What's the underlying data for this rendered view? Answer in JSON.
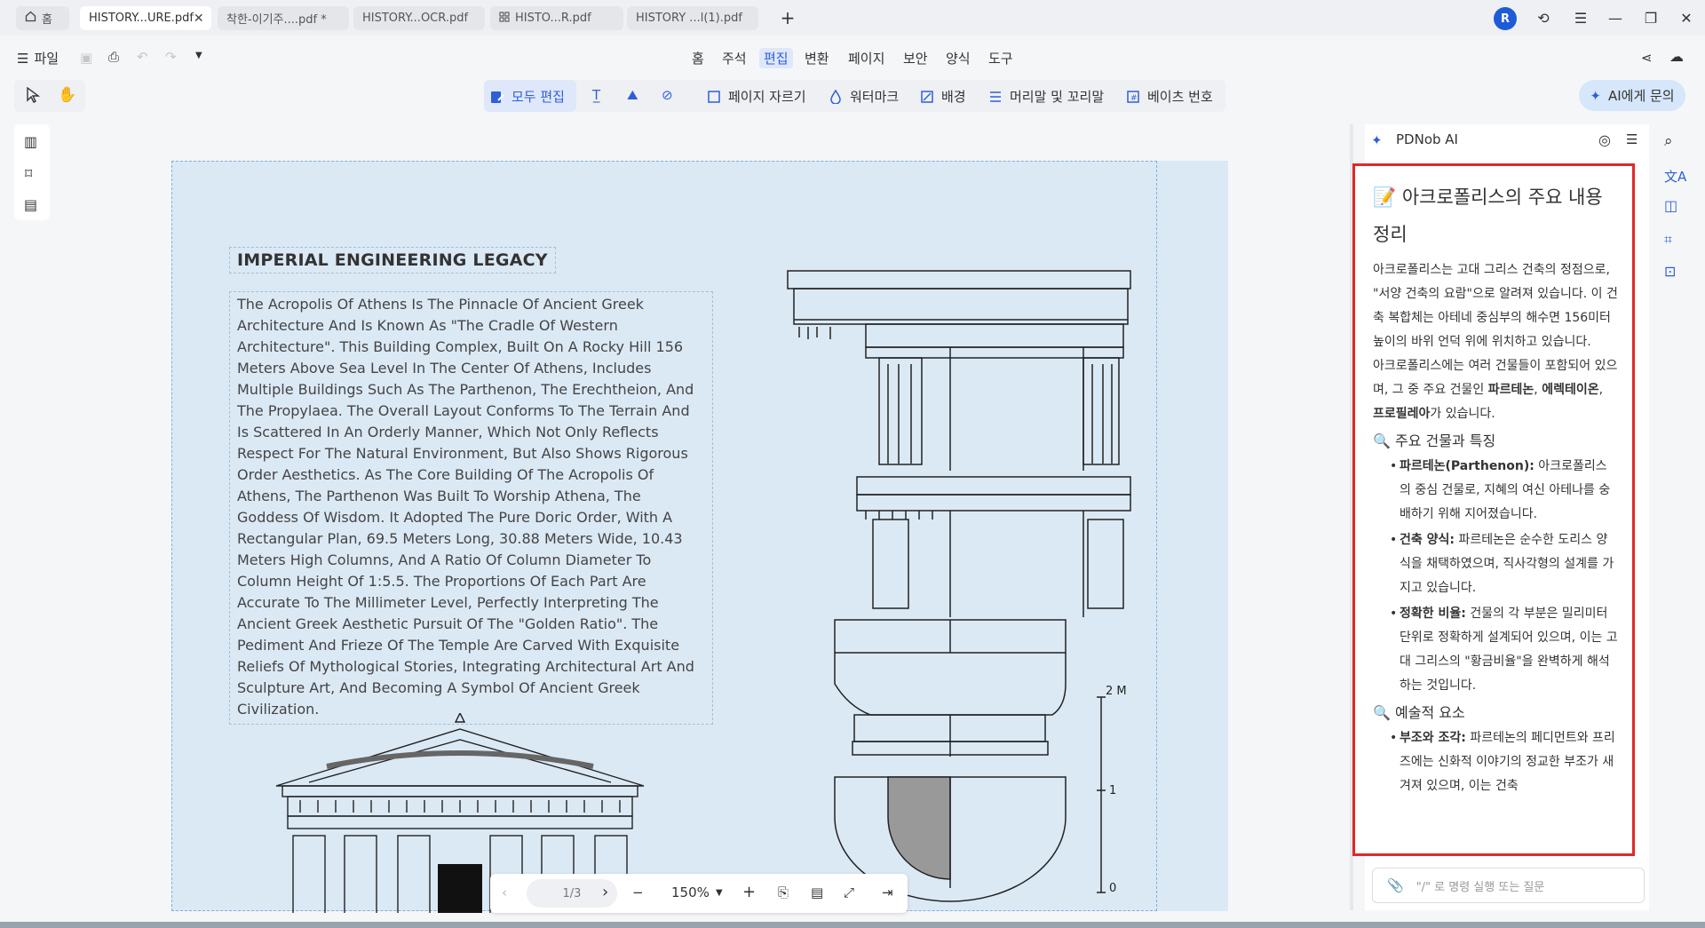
{
  "tabs": [
    {
      "label": "홈",
      "icon": "home-icon"
    },
    {
      "label": "HISTORY...URE.pdf",
      "active": true
    },
    {
      "label": "착한-이기주....pdf *"
    },
    {
      "label": "HISTORY...OCR.pdf"
    },
    {
      "label": "HISTO...R.pdf",
      "icon": "grid-icon"
    },
    {
      "label": "HISTORY ...l(1).pdf"
    }
  ],
  "user": {
    "avatar_initial": "R"
  },
  "menu": {
    "file_label": "파일",
    "items": [
      "홈",
      "주석",
      "편집",
      "변환",
      "페이지",
      "보안",
      "양식",
      "도구"
    ],
    "active": "편집"
  },
  "toolbar": {
    "edit_all": "모두 편집",
    "crop_page": "페이지 자르기",
    "watermark": "워터마크",
    "background": "배경",
    "header_footer": "머리말 및 꼬리말",
    "bates": "베이츠 번호",
    "ask_ai": "AI에게 문의"
  },
  "document": {
    "title": "IMPERIAL ENGINEERING LEGACY",
    "body": "The Acropolis Of Athens Is The Pinnacle Of Ancient Greek Architecture And Is Known As \"The Cradle Of Western Architecture\". This Building Complex, Built On A Rocky Hill 156 Meters Above Sea Level In The Center Of Athens, Includes Multiple Buildings Such As The Parthenon, The Erechtheion, And The Propylaea. The Overall Layout Conforms To The Terrain And Is Scattered In An Orderly Manner, Which Not Only Reflects Respect For The Natural Environment, But Also Shows Rigorous Order Aesthetics. As The Core Building Of The Acropolis Of Athens, The Parthenon Was Built To Worship Athena, The Goddess Of Wisdom. It Adopted The Pure Doric Order, With A Rectangular Plan, 69.5 Meters Long, 30.88 Meters Wide, 10.43 Meters High Columns, And A Ratio Of Column Diameter To Column Height Of 1:5.5. The Proportions Of Each Part Are Accurate To The Millimeter Level, Perfectly Interpreting The Ancient Greek Aesthetic Pursuit Of The \"Golden Ratio\". The Pediment And Frieze Of The Temple Are Carved With Exquisite Reliefs Of Mythological Stories, Integrating Architectural Art And Sculpture Art, And Becoming A Symbol Of Ancient Greek Civilization.",
    "scale_labels": [
      "2 M",
      "1",
      "0"
    ]
  },
  "navigation": {
    "page": "1/3",
    "zoom": "150%"
  },
  "ai_panel": {
    "title": "PDNob AI",
    "heading": "아크로폴리스의 주요 내용 정리",
    "intro1": "아크로폴리스는 고대 그리스 건축의 정점으로, \"서양 건축의 요람\"으로 알려져 있습니다. 이 건축 복합체는 아테네 중심부의 해수면 156미터 높이의 바위 언덕 위에 위치하고 있습니다.",
    "intro2_pre": "아크로폴리스에는 여러 건물들이 포함되어 있으며, 그 중 주요 건물인 ",
    "intro2_b1": "파르테논",
    "intro2_sep1": ", ",
    "intro2_b2": "에렉테이온",
    "intro2_sep2": ", ",
    "intro2_b3": "프로필레아",
    "intro2_post": "가 있습니다.",
    "section1": "주요 건물과 특징",
    "items1": [
      {
        "b": "파르테논(Parthenon):",
        "t": " 아크로폴리스의 중심 건물로, 지혜의 여신 아테나를 숭배하기 위해 지어졌습니다."
      },
      {
        "b": "건축 양식:",
        "t": " 파르테논은 순수한 도리스 양식을 채택하였으며, 직사각형의 설계를 가지고 있습니다."
      },
      {
        "b": "정확한 비율:",
        "t": " 건물의 각 부분은 밀리미터 단위로 정확하게 설계되어 있으며, 이는 고대 그리스의 \"황금비율\"을 완벽하게 해석하는 것입니다."
      }
    ],
    "section2": "예술적 요소",
    "items2": [
      {
        "b": "부조와 조각:",
        "t": " 파르테논의 페디먼트와 프리즈에는 신화적 이야기의 정교한 부조가 새겨져 있으며, 이는 건축"
      }
    ],
    "input_placeholder": "\"/\" 로 명령 실행 또는 질문"
  }
}
